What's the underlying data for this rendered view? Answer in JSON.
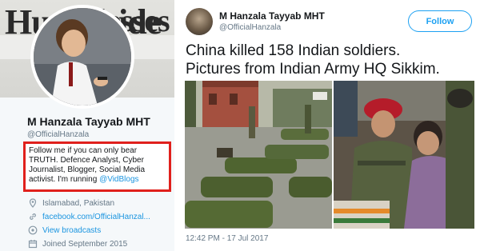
{
  "profile": {
    "banner_left_word": "Hug",
    "banner_mid_word": "losses",
    "banner_right_word": "ide",
    "name": "M Hanzala Tayyab MHT",
    "handle": "@OfficialHanzala",
    "bio": "Follow me if you can only bear TRUTH. Defence Analyst, Cyber Journalist, Blogger, Social Media activist. I'm running",
    "bio_link": "@VidBlogs",
    "location": "Islamabad, Pakistan",
    "website": "facebook.com/OfficialHanzal...",
    "broadcasts": "View broadcasts",
    "joined": "Joined September 2015",
    "highlight_color": "#e0201c",
    "link_color": "#1b95e0"
  },
  "tweet": {
    "name": "M Hanzala Tayyab MHT",
    "handle": "@OfficialHanzala",
    "follow_label": "Follow",
    "text_line1": "China killed 158 Indian soldiers.",
    "text_line2": "Pictures from Indian Army HQ Sikkim.",
    "timestamp": "12:42 PM - 17 Jul 2017",
    "accent_color": "#1da1f2"
  },
  "icons": {
    "location": "location-pin-icon",
    "website": "link-icon",
    "broadcasts": "broadcast-icon",
    "joined": "calendar-icon"
  }
}
